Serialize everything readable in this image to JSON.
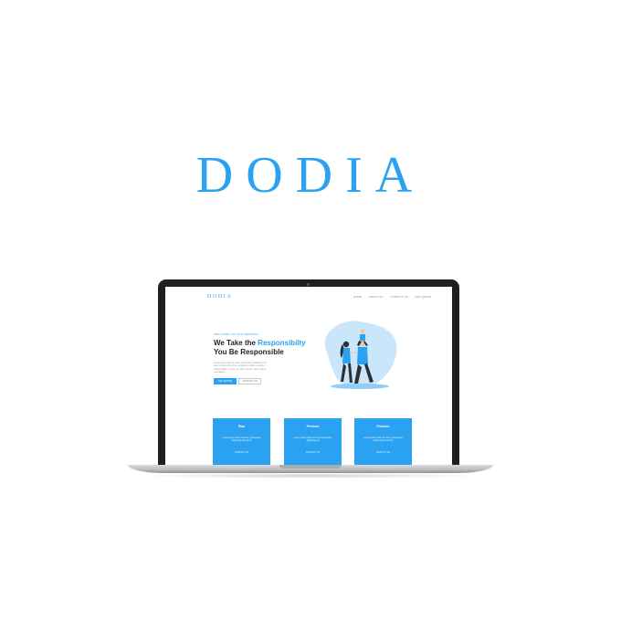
{
  "brand": {
    "title": "DODIA"
  },
  "site": {
    "logo": "DODIA",
    "nav": [
      "HOME",
      "ABOUT US",
      "CONTACT US",
      "GET QUOTE"
    ],
    "hero": {
      "eyebrow": "WELCOME TO OUR WEBSITE",
      "heading_line1_prefix": "We Take the ",
      "heading_line1_accent": "Responsibilty",
      "heading_line2": "You Be Responsible",
      "copy": "Lorem ipsum dolor sit amet, consectetur adipiscing elit, sed do eiusmod tempor incididunt ut labore et dolore magna aliqua. Ut enim ad minim veniam, quis nostrud exercitation.",
      "primary_button": "GET QUOTE",
      "secondary_button": "CONTACT US"
    },
    "cards": [
      {
        "title": "Plan",
        "text": "Lorem ipsum dolor sit amet, consectetur adipiscing elit sed do",
        "link": "CONTACT US"
      },
      {
        "title": "Perform",
        "text": "Lorem ipsum dolor sit amet consectetur adipiscing elit",
        "link": "CONTACT US"
      },
      {
        "title": "Practice",
        "text": "Lorem ipsum dolor sit amet, consectetur adipiscing elit sed do",
        "link": "CONTACT US"
      }
    ]
  },
  "colors": {
    "accent": "#2aa1f1",
    "dark": "#1f2329",
    "laptop": "#1d1f22"
  }
}
